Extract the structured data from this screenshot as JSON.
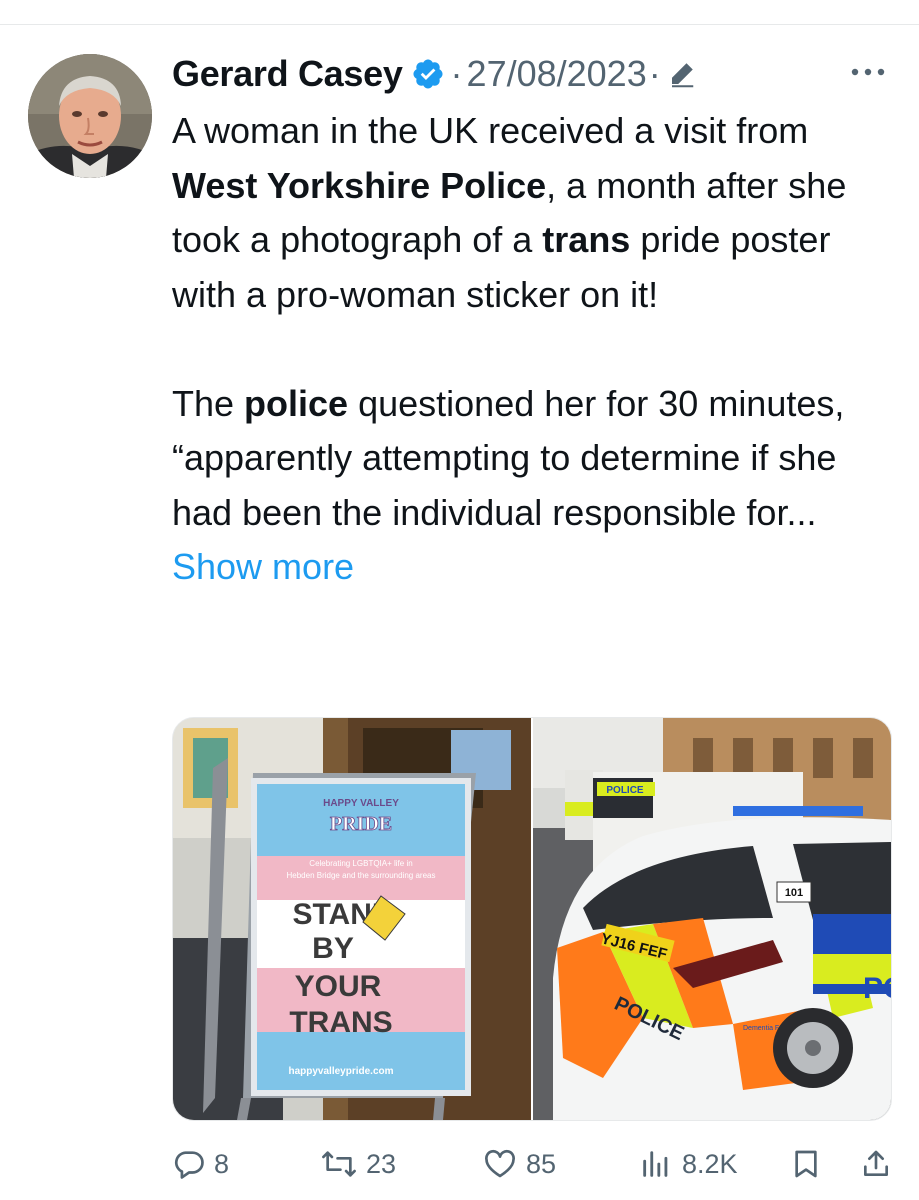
{
  "tweet": {
    "author_name": "Gerard Casey",
    "verified": true,
    "separator": "·",
    "date": "27/08/2023",
    "date_suffix": "·",
    "body": {
      "p1_a": "A woman in the UK received a visit from ",
      "p1_b": "West Yorkshire Police",
      "p1_c": ", a month after she took a photograph of a ",
      "p1_d": "trans",
      "p1_e": " pride poster with a pro-woman sticker on it!",
      "p2_a": "The ",
      "p2_b": "police",
      "p2_c": " questioned her for 30 minutes, “apparently attempting to determine if she had been the individual responsible for...",
      "show_more": "Show more"
    },
    "media": {
      "left_photo": {
        "poster_top": "HAPPY VALLEY",
        "poster_title": "PRIDE",
        "poster_line1": "Celebrating LGBTQIA+ life in",
        "poster_line2": "Hebden Bridge and the surrounding areas",
        "poster_stand": "STAND",
        "poster_by": "BY",
        "poster_your": "YOUR",
        "poster_trans": "TRANS",
        "poster_url": "happyvalleypride.com"
      },
      "right_photo": {
        "van_sign": "POLICE",
        "plate": "YJ16 FEF",
        "car_text": "POLICE",
        "door_number": "101",
        "door_text": "PO",
        "dementia_label": "Dementia Friendly"
      }
    },
    "actions": {
      "replies": "8",
      "retweets": "23",
      "likes": "85",
      "views": "8.2K"
    }
  },
  "colors": {
    "accent": "#1d9bf0",
    "muted": "#536471",
    "text": "#0f1419",
    "police_yellow": "#d9ec1f",
    "police_blue": "#1f4bb6"
  },
  "icons": [
    "verified-badge-icon",
    "edit-pencil-icon",
    "more-options-icon",
    "reply-icon",
    "retweet-icon",
    "like-icon",
    "views-icon",
    "bookmark-icon",
    "share-icon"
  ]
}
